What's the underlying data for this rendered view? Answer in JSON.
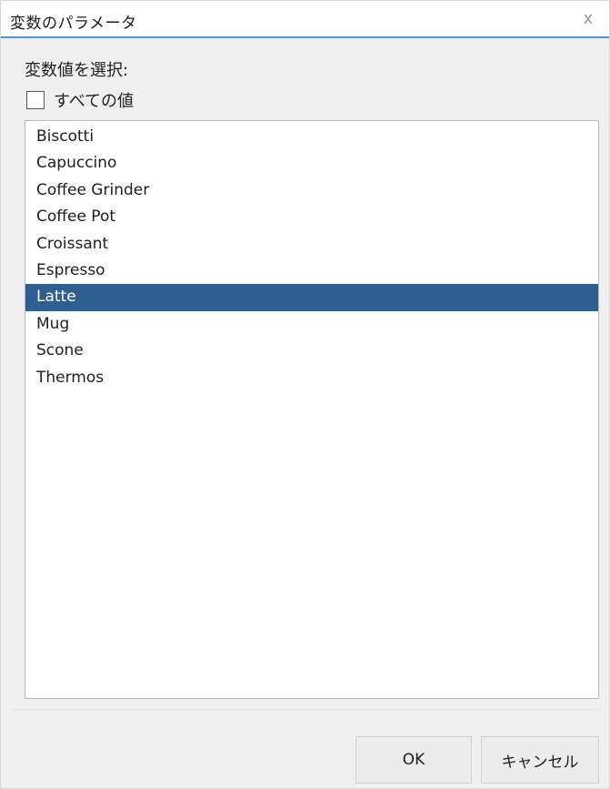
{
  "dialog": {
    "title": "変数のパラメータ",
    "close_glyph": "x"
  },
  "prompt": {
    "label": "変数値を選択:"
  },
  "all_values": {
    "label": "すべての値",
    "checked": false
  },
  "list": {
    "items": [
      {
        "label": "Biscotti",
        "selected": false
      },
      {
        "label": "Capuccino",
        "selected": false
      },
      {
        "label": "Coffee Grinder",
        "selected": false
      },
      {
        "label": "Coffee Pot",
        "selected": false
      },
      {
        "label": "Croissant",
        "selected": false
      },
      {
        "label": "Espresso",
        "selected": false
      },
      {
        "label": "Latte",
        "selected": true
      },
      {
        "label": "Mug",
        "selected": false
      },
      {
        "label": "Scone",
        "selected": false
      },
      {
        "label": "Thermos",
        "selected": false
      }
    ],
    "selected_color": "#2f5f91"
  },
  "buttons": {
    "ok_label": "OK",
    "cancel_label": "キャンセル"
  },
  "colors": {
    "title_underline": "#5b8fc9",
    "dialog_bg": "#f0f0f0"
  }
}
